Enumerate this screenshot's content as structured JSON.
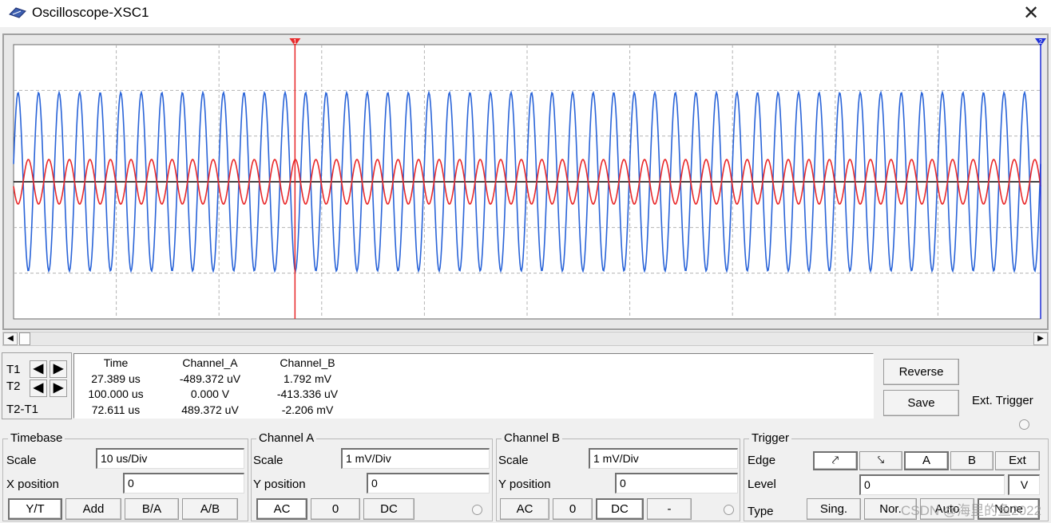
{
  "window": {
    "title": "Oscilloscope-XSC1",
    "close_glyph": "✕",
    "icon": "oscilloscope-app-icon"
  },
  "display": {
    "background": "#ffffff",
    "grid_color": "#b4b4b4",
    "channel_a_color": "#e8292b",
    "channel_b_color": "#2a64d8",
    "cursor_t1_color": "#e8292b",
    "cursor_t2_color": "#1e2fd8",
    "cursor_t1_label": "1",
    "cursor_t2_label": "2"
  },
  "cursors": {
    "t1_label": "T1",
    "t2_label": "T2",
    "diff_label": "T2-T1",
    "left_arrow": "◀",
    "right_arrow": "▶"
  },
  "readout": {
    "headers": {
      "time": "Time",
      "channel_a": "Channel_A",
      "channel_b": "Channel_B"
    },
    "rows": [
      {
        "time": "27.389 us",
        "channel_a": "-489.372 uV",
        "channel_b": "1.792 mV"
      },
      {
        "time": "100.000 us",
        "channel_a": "0.000 V",
        "channel_b": "-413.336 uV"
      },
      {
        "time": "72.611 us",
        "channel_a": "489.372 uV",
        "channel_b": "-2.206 mV"
      }
    ]
  },
  "actions": {
    "reverse": "Reverse",
    "save": "Save",
    "ext_trigger": "Ext. Trigger"
  },
  "timebase": {
    "title": "Timebase",
    "scale_label": "Scale",
    "scale_value": "10 us/Div",
    "xpos_label": "X position",
    "xpos_value": "0",
    "modes": [
      "Y/T",
      "Add",
      "B/A",
      "A/B"
    ]
  },
  "channel_a": {
    "title": "Channel A",
    "scale_label": "Scale",
    "scale_value": "1 mV/Div",
    "ypos_label": "Y position",
    "ypos_value": "0",
    "coupling": [
      "AC",
      "0",
      "DC"
    ]
  },
  "channel_b": {
    "title": "Channel B",
    "scale_label": "Scale",
    "scale_value": "1 mV/Div",
    "ypos_label": "Y position",
    "ypos_value": "0",
    "coupling": [
      "AC",
      "0",
      "DC",
      "-"
    ]
  },
  "trigger": {
    "title": "Trigger",
    "edge_label": "Edge",
    "edges": [
      "⤤",
      "⤥",
      "A",
      "B",
      "Ext"
    ],
    "level_label": "Level",
    "level_value": "0",
    "level_unit": "V",
    "type_label": "Type",
    "types": [
      "Sing.",
      "Nor.",
      "Auto",
      "None"
    ]
  },
  "watermark": "CSDN @海里的鱼2022"
}
